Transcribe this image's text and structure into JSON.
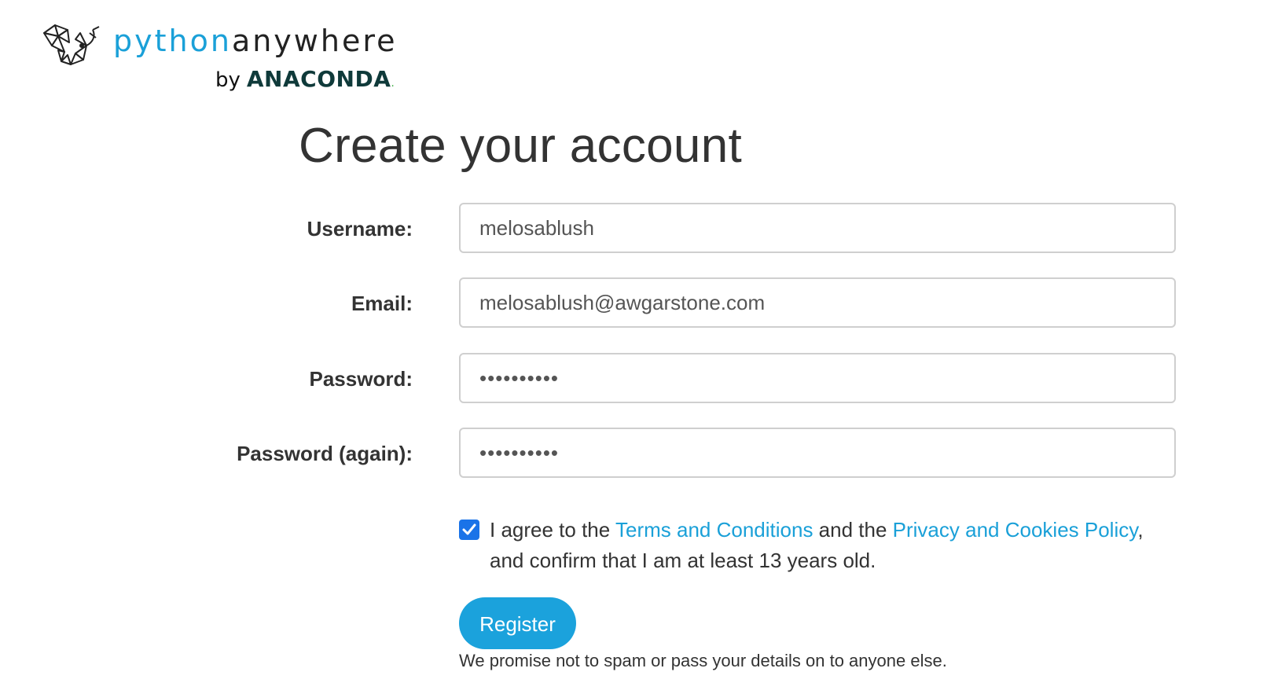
{
  "brand": {
    "python": "python",
    "anywhere": "anywhere",
    "by": "by",
    "anaconda": "ANACONDA",
    "dot": ".",
    "colors": {
      "python": "#1aa0d8",
      "anaconda": "#0f3a3a",
      "dot": "#43b049"
    },
    "icon": "origami-python-logo-icon"
  },
  "title": "Create your account",
  "form": {
    "username": {
      "label": "Username:",
      "value": "melosablush"
    },
    "email": {
      "label": "Email:",
      "value": "melosablush@awgarstone.com"
    },
    "password": {
      "label": "Password:",
      "value": "••••••••••"
    },
    "password_again": {
      "label": "Password (again):",
      "value": "••••••••••"
    }
  },
  "agreement": {
    "checked": true,
    "text_1": "I agree to the ",
    "terms_link": "Terms and Conditions",
    "text_2": " and the ",
    "privacy_link": "Privacy and Cookies Policy",
    "text_3": ", and confirm that I am at least 13 years old."
  },
  "register_button": "Register",
  "promise_text": "We promise not to spam or pass your details on to anyone else.",
  "colors": {
    "accent": "#1ba2dc",
    "checkbox": "#1a73e8",
    "text": "#333333"
  }
}
